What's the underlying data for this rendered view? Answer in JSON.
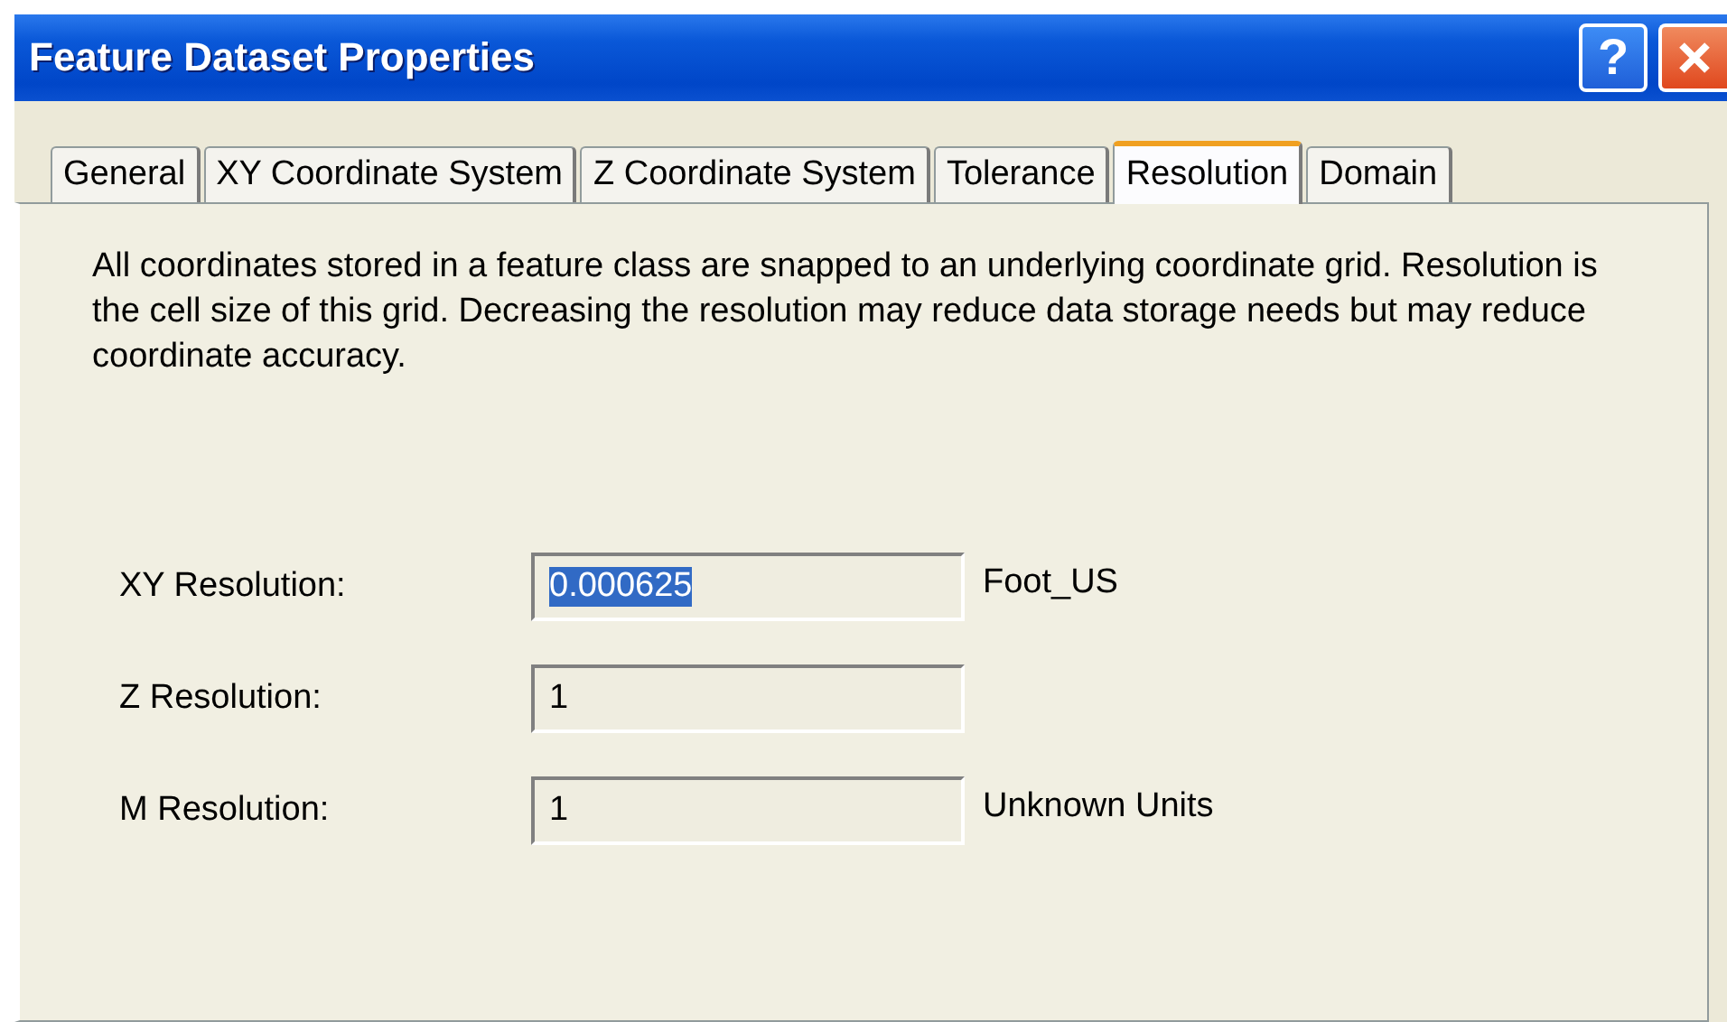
{
  "window": {
    "title": "Feature Dataset Properties",
    "buttons": [
      {
        "kind": "help",
        "label": "?"
      },
      {
        "kind": "close"
      }
    ]
  },
  "tabs": [
    {
      "label": "General",
      "selected": false
    },
    {
      "label": "XY Coordinate System",
      "selected": false
    },
    {
      "label": "Z Coordinate System",
      "selected": false
    },
    {
      "label": "Tolerance",
      "selected": false
    },
    {
      "label": "Resolution",
      "selected": true
    },
    {
      "label": "Domain",
      "selected": false
    }
  ],
  "description": "All coordinates stored in a feature class are snapped to an underlying coordinate grid. Resolution is the cell size of this grid. Decreasing the resolution may reduce data storage needs but may reduce coordinate accuracy.",
  "fields": [
    {
      "label": "XY Resolution:",
      "value": "0.000625",
      "text_selected": true,
      "units": "Foot_US"
    },
    {
      "label": "Z Resolution:",
      "value": "1",
      "text_selected": false
    },
    {
      "label": "M Resolution:",
      "value": "1",
      "text_selected": false,
      "units": "Unknown Units"
    }
  ]
}
